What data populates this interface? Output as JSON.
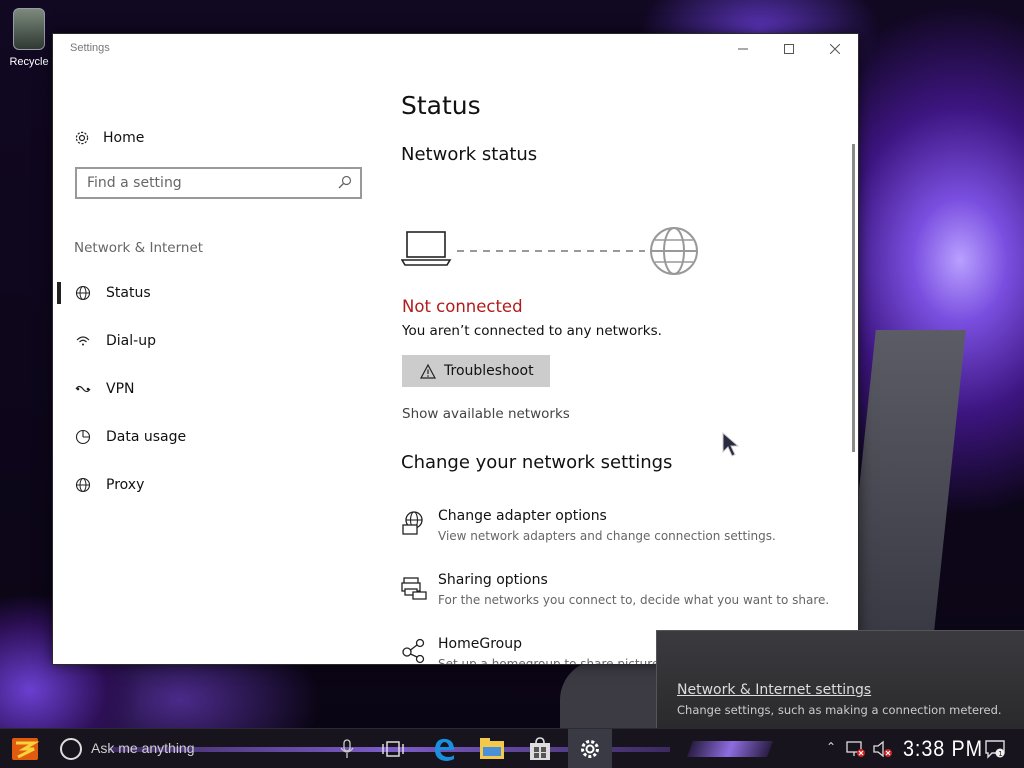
{
  "desktop": {
    "recycle_label": "Recycle"
  },
  "window": {
    "title": "Settings",
    "minimize_icon": "minimize-icon",
    "maximize_icon": "maximize-icon",
    "close_icon": "close-icon"
  },
  "sidebar": {
    "home_label": "Home",
    "search_placeholder": "Find a setting",
    "section_title": "Network & Internet",
    "items": [
      {
        "label": "Status",
        "icon": "globe-icon",
        "active": true
      },
      {
        "label": "Dial-up",
        "icon": "dialup-icon",
        "active": false
      },
      {
        "label": "VPN",
        "icon": "vpn-icon",
        "active": false
      },
      {
        "label": "Data usage",
        "icon": "pie-chart-icon",
        "active": false
      },
      {
        "label": "Proxy",
        "icon": "globe-icon",
        "active": false
      }
    ]
  },
  "main": {
    "title": "Status",
    "network_status_heading": "Network status",
    "connection_state": "Not connected",
    "connection_desc": "You aren’t connected to any networks.",
    "troubleshoot_label": "Troubleshoot",
    "show_networks_label": "Show available networks",
    "change_heading": "Change your network settings",
    "options": [
      {
        "title": "Change adapter options",
        "desc": "View network adapters and change connection settings.",
        "icon": "adapter-icon"
      },
      {
        "title": "Sharing options",
        "desc": "For the networks you connect to, decide what you want to share.",
        "icon": "sharing-icon"
      },
      {
        "title": "HomeGroup",
        "desc": "Set up a homegroup to share pictures",
        "icon": "homegroup-icon"
      }
    ],
    "colors": {
      "error": "#b31b1b",
      "button_bg": "#cccccc"
    }
  },
  "flyout": {
    "link": "Network & Internet settings",
    "desc": "Change settings, such as making a connection metered."
  },
  "taskbar": {
    "search_placeholder": "Ask me anything",
    "clock": "3:38 PM"
  }
}
